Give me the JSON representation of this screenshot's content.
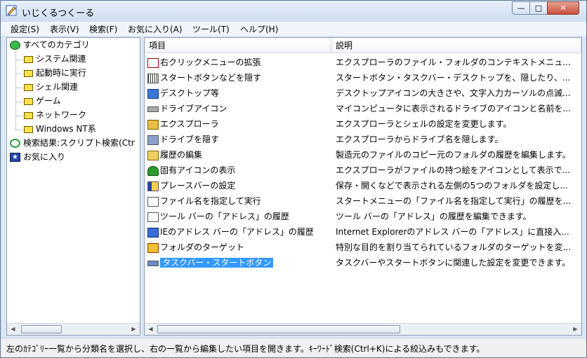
{
  "window": {
    "title": "いじくるつくーる",
    "min_label": "—",
    "max_label": "□",
    "close_label": "✕"
  },
  "menubar": [
    {
      "label": "設定(S)"
    },
    {
      "label": "表示(V)"
    },
    {
      "label": "検索(F)"
    },
    {
      "label": "お気に入り(A)"
    },
    {
      "label": "ツール(T)"
    },
    {
      "label": "ヘルプ(H)"
    }
  ],
  "tree": {
    "items": [
      {
        "label": "すべてのカテゴリ",
        "icon": "globe-icon"
      },
      {
        "label": "システム関連",
        "icon": "folder-icon"
      },
      {
        "label": "起動時に実行",
        "icon": "folder-icon"
      },
      {
        "label": "シェル関連",
        "icon": "folder-icon"
      },
      {
        "label": "ゲーム",
        "icon": "folder-icon"
      },
      {
        "label": "ネットワーク",
        "icon": "folder-icon"
      },
      {
        "label": "Windows NT系",
        "icon": "folder-icon"
      },
      {
        "label": "検索結果:スクリプト検索(Ctr",
        "icon": "search-icon"
      },
      {
        "label": "お気に入り",
        "icon": "star-icon"
      }
    ]
  },
  "list": {
    "columns": [
      {
        "label": "項目"
      },
      {
        "label": "説明"
      }
    ],
    "rows": [
      {
        "name": "右クリックメニューの拡張",
        "desc": "エクスプローラのファイル・フォルダのコンテキストメニュ...",
        "icon": "context-menu-icon"
      },
      {
        "name": "スタートボタンなどを隠す",
        "desc": "スタートボタン・タスクバー・デスクトップを、隠したり、...",
        "icon": "hide-icon"
      },
      {
        "name": "デスクトップ等",
        "desc": "デスクトップアイコンの大きさや、文字入力カーソルの点滅...",
        "icon": "desktop-icon"
      },
      {
        "name": "ドライブアイコン",
        "desc": "マイコンピュータに表示されるドライブのアイコンと名前を...",
        "icon": "drive-icon"
      },
      {
        "name": "エクスプローラ",
        "desc": "エクスプローラとシェルの設定を変更します。",
        "icon": "explorer-icon"
      },
      {
        "name": "ドライブを隠す",
        "desc": "エクスプローラからドライブ名を隠します。",
        "icon": "drive-hide-icon"
      },
      {
        "name": "履歴の編集",
        "desc": "製造元のファイルのコピー元のフォルダの履歴を編集します。",
        "icon": "history-icon"
      },
      {
        "name": "固有アイコンの表示",
        "desc": "エクスプローラがファイルの持つ絵をアイコンとして表示で...",
        "icon": "tree-icon"
      },
      {
        "name": "プレースバーの設定",
        "desc": "保存・開くなどで表示される左側の5つのフォルダを設定し...",
        "icon": "places-bar-icon"
      },
      {
        "name": "ファイル名を指定して実行",
        "desc": "スタートメニューの「ファイル名を指定して実行」の履歴を...",
        "icon": "run-icon"
      },
      {
        "name": "ツール バーの「アドレス」の履歴",
        "desc": "ツール バーの「アドレス」の履歴を編集できます。",
        "icon": "http-icon"
      },
      {
        "name": "IEのアドレス バーの「アドレス」の履歴",
        "desc": "Internet Explorerのアドレス バーの「アドレス」に直接入...",
        "icon": "ie-icon"
      },
      {
        "name": "フォルダのターゲット",
        "desc": "特別な目的を割り当てられているフォルダのターゲットを変...",
        "icon": "folder-target-icon"
      },
      {
        "name": "タスクバー・スタートボタン",
        "desc": "タスクバーやスタートボタンに関連した設定を変更できます。",
        "icon": "taskbar-icon",
        "selected": true
      }
    ]
  },
  "status": {
    "text": "左のｶﾃｺﾞﾘｰ一覧から分類名を選択し、右の一覧から編集したい項目を開きます。ｷｰﾜｰﾄﾞ検索(Ctrl+K)による絞込みもできます。"
  },
  "scroll": {
    "left_arrow": "◀",
    "right_arrow": "▶"
  }
}
